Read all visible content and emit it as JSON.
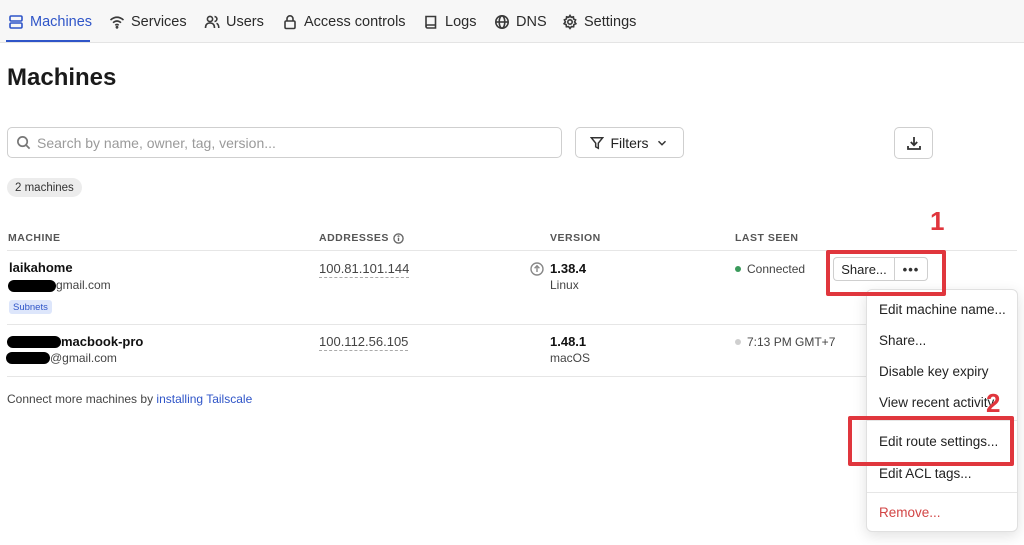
{
  "nav": {
    "items": [
      {
        "label": "Machines",
        "icon": "server-icon"
      },
      {
        "label": "Services",
        "icon": "wifi-icon"
      },
      {
        "label": "Users",
        "icon": "users-icon"
      },
      {
        "label": "Access controls",
        "icon": "lock-icon"
      },
      {
        "label": "Logs",
        "icon": "book-icon"
      },
      {
        "label": "DNS",
        "icon": "globe-icon"
      },
      {
        "label": "Settings",
        "icon": "gear-icon"
      }
    ],
    "active": "Machines"
  },
  "page": {
    "title": "Machines",
    "search_placeholder": "Search by name, owner, tag, version...",
    "filters_label": "Filters",
    "count_label": "2 machines"
  },
  "table": {
    "columns": [
      "MACHINE",
      "ADDRESSES",
      "VERSION",
      "LAST SEEN"
    ],
    "rows": [
      {
        "name": "laikahome",
        "email": "gmail.com",
        "tag": "Subnets",
        "address": "100.81.101.144",
        "version": "1.38.4",
        "os": "Linux",
        "last_seen": "Connected",
        "status_color": "#3a9a5b"
      },
      {
        "name": "macbook-pro",
        "email": "@gmail.com",
        "address": "100.112.56.105",
        "version": "1.48.1",
        "os": "macOS",
        "last_seen": "7:13 PM GMT+7",
        "status_color": "#cfcfcf"
      }
    ],
    "share_label": "Share...",
    "more_label": "•••"
  },
  "footer": {
    "prefix": "Connect more machines by ",
    "link": "installing Tailscale"
  },
  "menu": {
    "items": [
      "Edit machine name...",
      "Share...",
      "Disable key expiry",
      "View recent activity",
      "Edit route settings...",
      "Edit ACL tags...",
      "Remove..."
    ]
  },
  "annotations": {
    "label_1": "1",
    "label_2": "2",
    "color": "#e0363d"
  },
  "colors": {
    "accent": "#2f55c8",
    "danger": "#d24545"
  }
}
